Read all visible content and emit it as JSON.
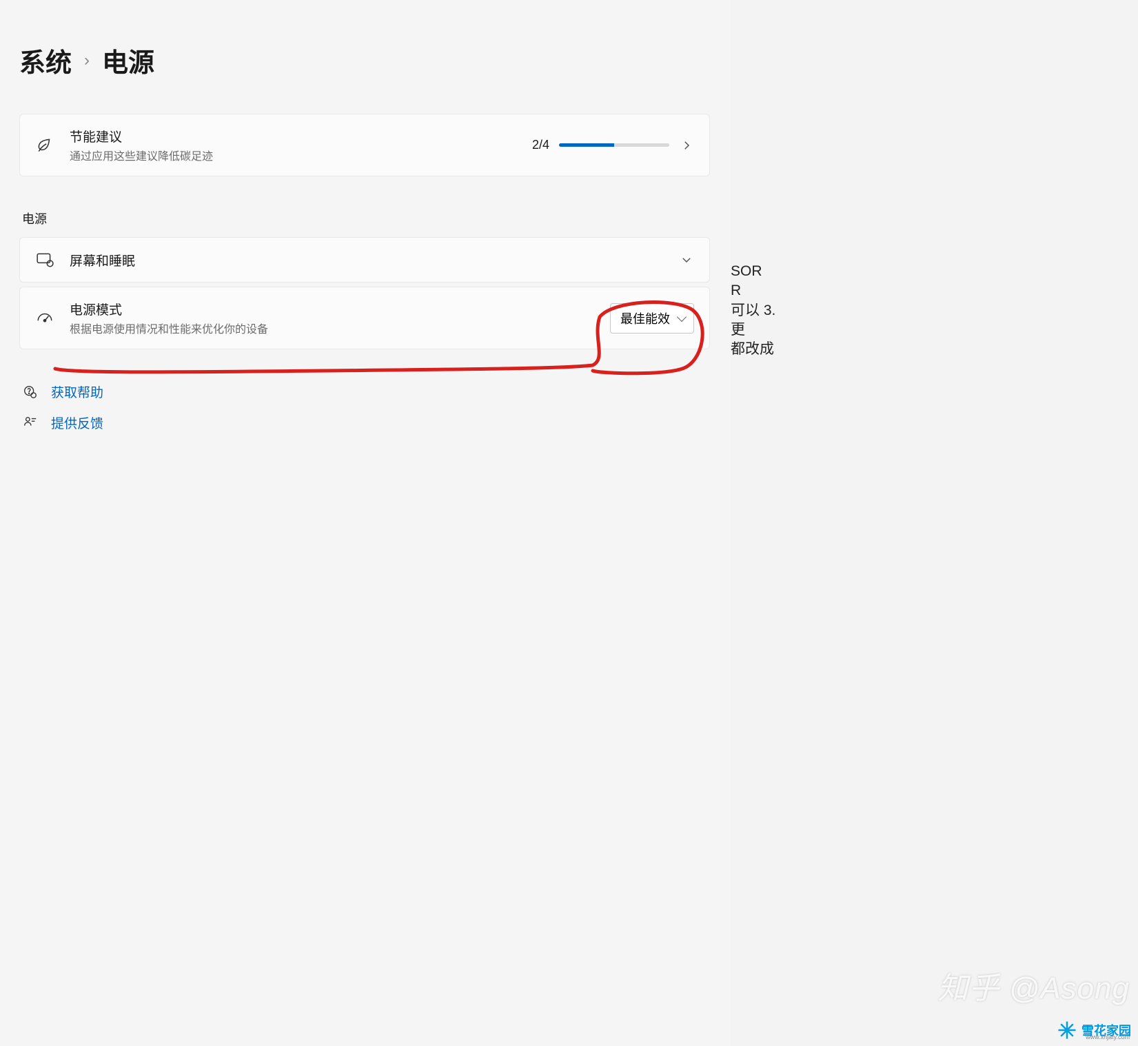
{
  "breadcrumb": {
    "parent": "系统",
    "current": "电源"
  },
  "energy_card": {
    "title": "节能建议",
    "subtitle": "通过应用这些建议降低碳足迹",
    "progress_text": "2/4",
    "progress_percent": 50
  },
  "section_label": "电源",
  "screen_card": {
    "title": "屏幕和睡眠"
  },
  "mode_card": {
    "title": "电源模式",
    "subtitle": "根据电源使用情况和性能来优化你的设备",
    "selected": "最佳能效"
  },
  "links": {
    "help": "获取帮助",
    "feedback": "提供反馈"
  },
  "side_fragments": [
    "SOR",
    "R",
    "可以 3.更",
    "都改成"
  ],
  "watermark1": "知乎 @Asong",
  "watermark2": {
    "text": "雪花家园",
    "sub": "www.xhjaty.com"
  }
}
